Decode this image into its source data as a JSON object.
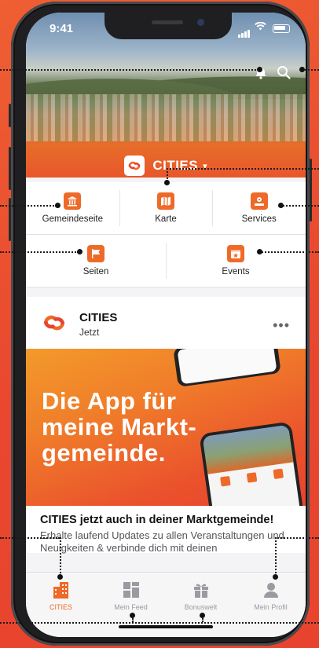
{
  "status_bar": {
    "time": "9:41"
  },
  "header": {
    "brand_name": "CITIES",
    "icons": [
      "bell-icon",
      "search-icon",
      "chevron-down-icon"
    ]
  },
  "quick_actions": {
    "row1": [
      {
        "label": "Gemeindeseite",
        "icon": "town-hall-icon"
      },
      {
        "label": "Karte",
        "icon": "map-icon"
      },
      {
        "label": "Services",
        "icon": "services-icon"
      }
    ],
    "row2": [
      {
        "label": "Seiten",
        "icon": "flag-icon"
      },
      {
        "label": "Events",
        "icon": "calendar-star-icon"
      }
    ]
  },
  "post": {
    "author": "CITIES",
    "time": "Jetzt",
    "banner_lines": [
      "Die App für",
      "meine Markt-",
      "gemeinde."
    ],
    "title": "CITIES jetzt auch in deiner Marktgemeinde!",
    "body": "Erhalte laufend Updates zu allen Veranstaltungen und Neuigkeiten & verbinde dich mit deinen"
  },
  "tabbar": {
    "tabs": [
      {
        "label": "CITIES",
        "icon": "city-buildings-icon",
        "active": true
      },
      {
        "label": "Mein Feed",
        "icon": "feed-grid-icon",
        "active": false
      },
      {
        "label": "Bonuswelt",
        "icon": "gift-icon",
        "active": false
      },
      {
        "label": "Mein Profil",
        "icon": "profile-icon",
        "active": false
      }
    ]
  },
  "colors": {
    "accent": "#EE6A28",
    "background": "#E9472F"
  }
}
